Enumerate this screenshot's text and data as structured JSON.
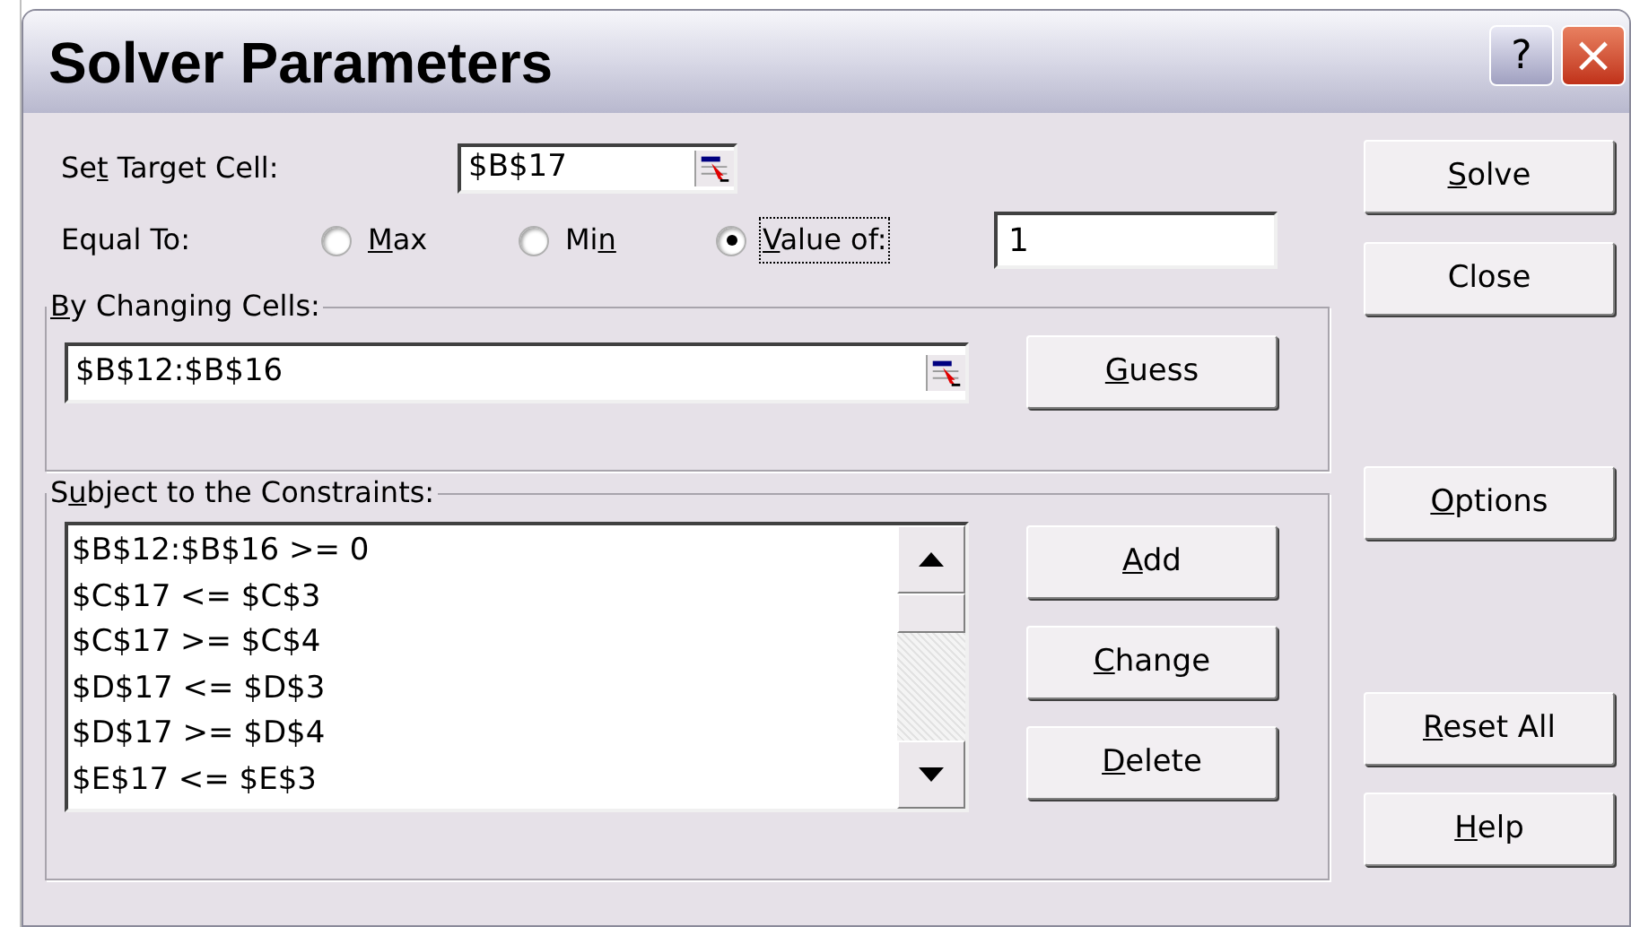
{
  "window": {
    "title": "Solver Parameters",
    "controls": [
      "?",
      "×"
    ]
  },
  "target_cell": {
    "label": {
      "pre": "Se",
      "key": "t",
      "post": " Target Cell:"
    },
    "value": "$B$17"
  },
  "equal_to": {
    "label": "Equal To:",
    "options": [
      {
        "label": {
          "key": "M",
          "post": "ax"
        },
        "selected": false
      },
      {
        "label": {
          "pre": "Mi",
          "key": "n"
        },
        "selected": false
      },
      {
        "label": {
          "key": "V",
          "post": "alue of:"
        },
        "selected": true
      }
    ],
    "value": "1"
  },
  "changing_cells": {
    "label": {
      "key": "B",
      "post": "y Changing Cells:"
    },
    "value": "$B$12:$B$16",
    "button": {
      "key": "G",
      "post": "uess"
    }
  },
  "constraints": {
    "label": {
      "pre": "S",
      "key": "u",
      "post": "bject to the Constraints:"
    },
    "items": [
      "$B$12:$B$16 >= 0",
      "$C$17 <= $C$3",
      "$C$17 >= $C$4",
      "$D$17 <= $D$3",
      "$D$17 >= $D$4",
      "$E$17 <= $E$3"
    ],
    "buttons": [
      {
        "key": "A",
        "post": "dd"
      },
      {
        "key": "C",
        "post": "hange"
      },
      {
        "key": "D",
        "post": "elete"
      }
    ]
  },
  "side_buttons": [
    {
      "key": "S",
      "post": "olve"
    },
    {
      "pre": "Close"
    },
    {
      "key": "O",
      "post": "ptions"
    },
    {
      "key": "R",
      "post": "eset All"
    },
    {
      "key": "H",
      "post": "elp"
    }
  ]
}
